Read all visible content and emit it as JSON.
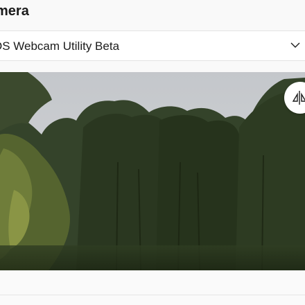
{
  "header": {
    "title": "mera"
  },
  "camera_select": {
    "selected": "OS Webcam Utility Beta",
    "chevron_icon": "chevron-down-icon"
  },
  "preview": {
    "description_icon": "camera-preview",
    "switch_icon": "flip-camera-icon"
  },
  "colors": {
    "sky": "#c9ccd0",
    "foliage_dark": "#25321b",
    "foliage_mid": "#4a5a34",
    "foliage_light": "#7d8a3e"
  }
}
